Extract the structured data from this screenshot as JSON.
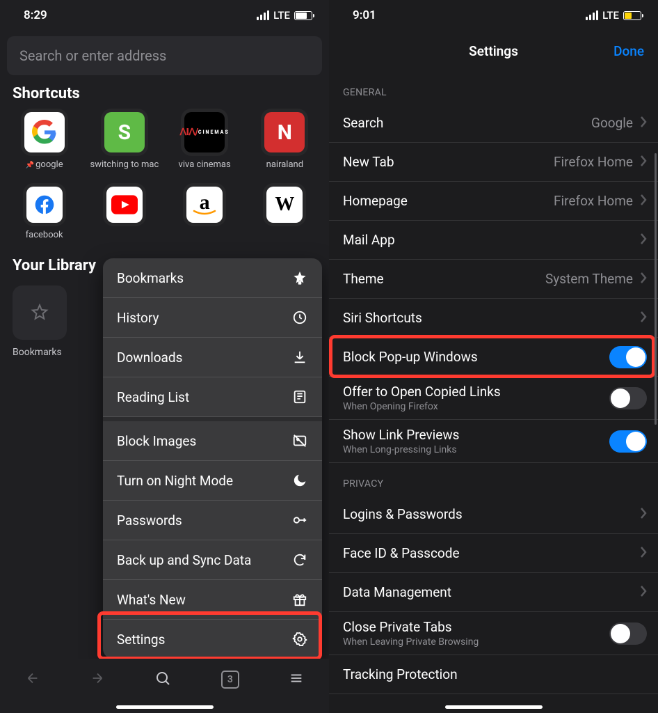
{
  "left": {
    "status": {
      "time": "8:29",
      "network": "LTE"
    },
    "search_placeholder": "Search or enter address",
    "shortcuts_title": "Shortcuts",
    "shortcuts": [
      {
        "label": "google",
        "pinned": true
      },
      {
        "label": "switching to mac"
      },
      {
        "label": "viva cinemas"
      },
      {
        "label": "nairaland"
      },
      {
        "label": "facebook"
      }
    ],
    "library_title": "Your Library",
    "bookmarks_label": "Bookmarks",
    "menu": [
      {
        "label": "Bookmarks",
        "icon": "star-icon"
      },
      {
        "label": "History",
        "icon": "clock-icon"
      },
      {
        "label": "Downloads",
        "icon": "download-icon"
      },
      {
        "label": "Reading List",
        "icon": "reading-icon"
      },
      {
        "label": "Block Images",
        "icon": "image-off-icon"
      },
      {
        "label": "Turn on Night Mode",
        "icon": "moon-icon"
      },
      {
        "label": "Passwords",
        "icon": "key-icon"
      },
      {
        "label": "Back up and Sync Data",
        "icon": "sync-icon"
      },
      {
        "label": "What's New",
        "icon": "gift-icon"
      },
      {
        "label": "Settings",
        "icon": "gear-icon"
      }
    ],
    "toolbar": {
      "tabs": "3"
    }
  },
  "right": {
    "status": {
      "time": "9:01",
      "network": "LTE"
    },
    "nav": {
      "title": "Settings",
      "done": "Done"
    },
    "groups": {
      "general": {
        "header": "General",
        "search": {
          "label": "Search",
          "value": "Google"
        },
        "newtab": {
          "label": "New Tab",
          "value": "Firefox Home"
        },
        "homepage": {
          "label": "Homepage",
          "value": "Firefox Home"
        },
        "mail": {
          "label": "Mail App"
        },
        "theme": {
          "label": "Theme",
          "value": "System Theme"
        },
        "siri": {
          "label": "Siri Shortcuts"
        },
        "popup": {
          "label": "Block Pop-up Windows"
        },
        "copied": {
          "label": "Offer to Open Copied Links",
          "sub": "When Opening Firefox"
        },
        "previews": {
          "label": "Show Link Previews",
          "sub": "When Long-pressing Links"
        }
      },
      "privacy": {
        "header": "Privacy",
        "logins": {
          "label": "Logins & Passwords"
        },
        "faceid": {
          "label": "Face ID & Passcode"
        },
        "datamgmt": {
          "label": "Data Management"
        },
        "closeprivate": {
          "label": "Close Private Tabs",
          "sub": "When Leaving Private Browsing"
        },
        "tracking": {
          "label": "Tracking Protection"
        }
      }
    }
  }
}
